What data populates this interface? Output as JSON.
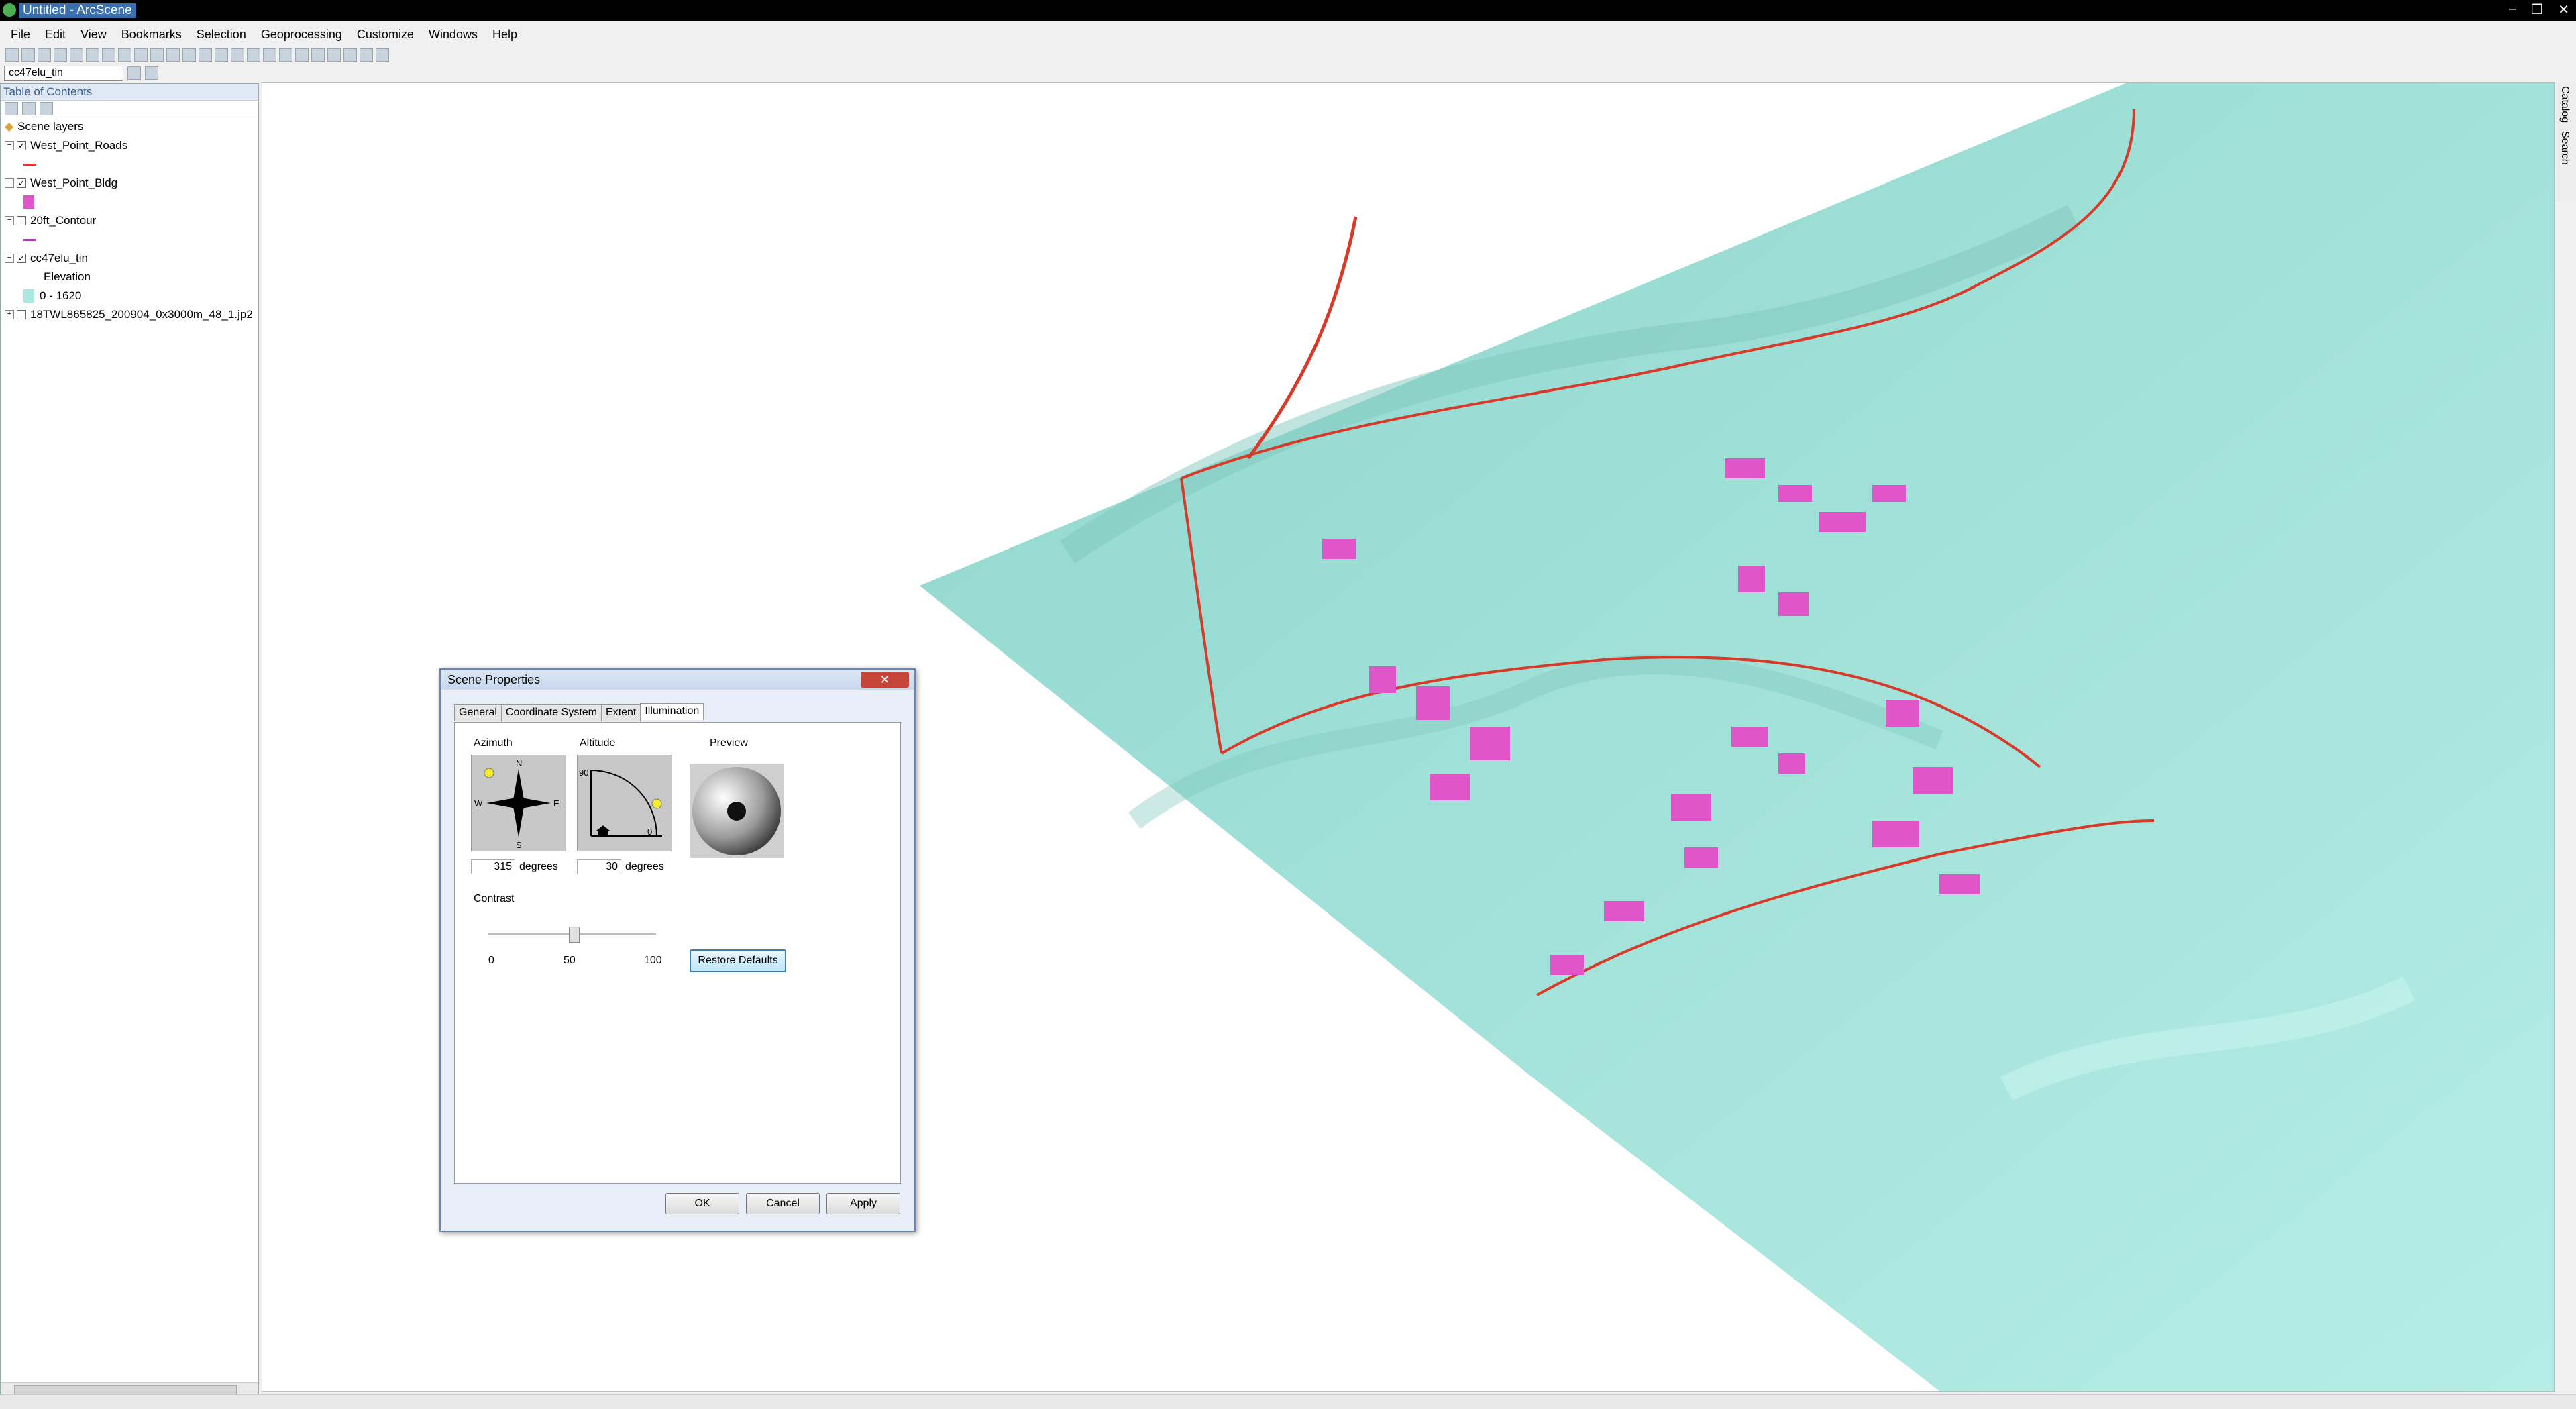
{
  "window": {
    "title": "Untitled - ArcScene",
    "controls": [
      "–",
      "❐",
      "✕"
    ]
  },
  "menu": [
    "File",
    "Edit",
    "View",
    "Bookmarks",
    "Selection",
    "Geoprocessing",
    "Customize",
    "Windows",
    "Help"
  ],
  "layer_combo": "cc47elu_tin",
  "toc": {
    "title": "Table of Contents",
    "scene_layers": "Scene layers",
    "layers": [
      {
        "name": "West_Point_Roads",
        "checked": true,
        "expanded": true,
        "swatch": "line",
        "color": "#e03030"
      },
      {
        "name": "West_Point_Bldg",
        "checked": true,
        "expanded": true,
        "swatch": "box",
        "color": "#e055c8"
      },
      {
        "name": "20ft_Contour",
        "checked": false,
        "expanded": true,
        "swatch": "line",
        "color": "#b040b0"
      },
      {
        "name": "cc47elu_tin",
        "checked": true,
        "expanded": true,
        "sub_label": "Elevation",
        "range": "0 - 1620",
        "color": "#a8e8df"
      },
      {
        "name": "18TWL865825_200904_0x3000m_48_1.jp2",
        "checked": false,
        "expanded": false
      }
    ]
  },
  "right_tabs": [
    "Catalog",
    "Search"
  ],
  "dialog": {
    "title": "Scene Properties",
    "close": "✕",
    "tabs": [
      "General",
      "Coordinate System",
      "Extent",
      "Illumination"
    ],
    "active_tab": "Illumination",
    "azimuth_label": "Azimuth",
    "altitude_label": "Altitude",
    "preview_label": "Preview",
    "azimuth_value": "315",
    "altitude_value": "30",
    "degrees": "degrees",
    "compass": {
      "n": "N",
      "s": "S",
      "e": "E",
      "w": "W"
    },
    "alt_marks": {
      "top": "90",
      "bottom": "0"
    },
    "contrast_label": "Contrast",
    "contrast_min": "0",
    "contrast_value": "50",
    "contrast_max": "100",
    "restore": "Restore Defaults",
    "ok": "OK",
    "cancel": "Cancel",
    "apply": "Apply"
  },
  "colors": {
    "terrain": "#a6e6dd",
    "roads": "#d83a2a",
    "buildings": "#e055c8",
    "accent": "#3c7fb1"
  }
}
